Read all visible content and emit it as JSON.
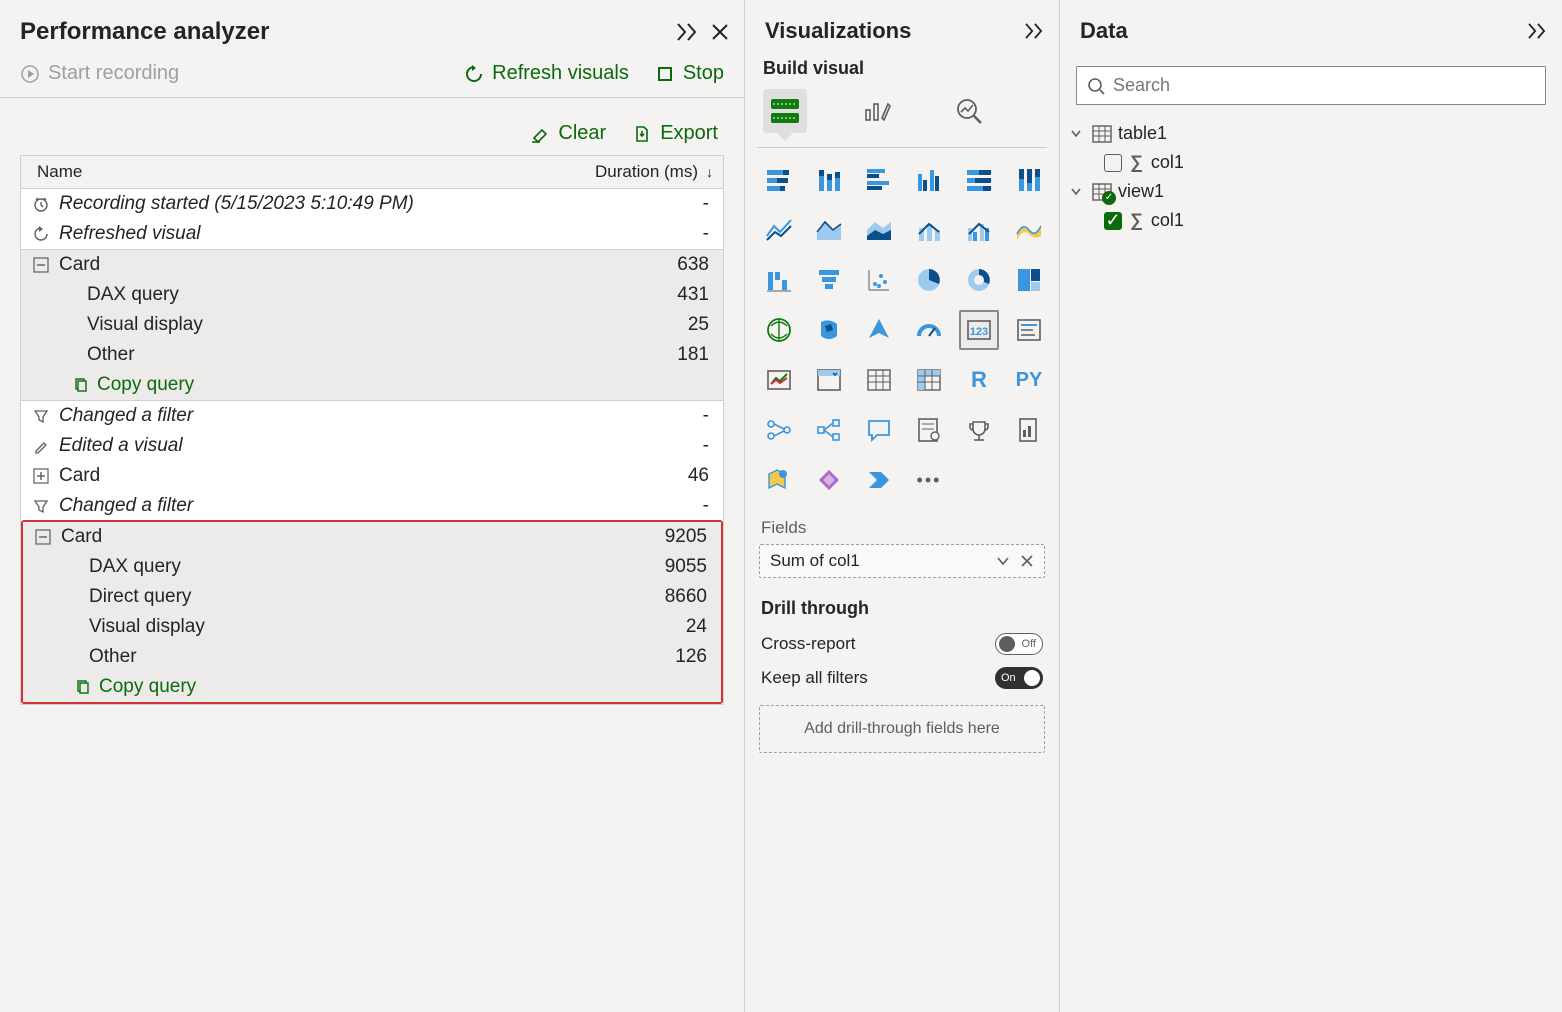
{
  "perf": {
    "title": "Performance analyzer",
    "start_recording": "Start recording",
    "refresh": "Refresh visuals",
    "stop": "Stop",
    "clear": "Clear",
    "export": "Export",
    "table": {
      "col_name": "Name",
      "col_duration": "Duration (ms)"
    },
    "rows": {
      "recording_started": "Recording started (5/15/2023 5:10:49 PM)",
      "refreshed_visual": "Refreshed visual",
      "card1": {
        "label": "Card",
        "dur": "638",
        "dax": "DAX query",
        "dax_dur": "431",
        "vd": "Visual display",
        "vd_dur": "25",
        "other": "Other",
        "other_dur": "181"
      },
      "copy_query": "Copy query",
      "changed_filter": "Changed a filter",
      "edited_visual": "Edited a visual",
      "card2": {
        "label": "Card",
        "dur": "46"
      },
      "changed_filter2": "Changed a filter",
      "card3": {
        "label": "Card",
        "dur": "9205",
        "dax": "DAX query",
        "dax_dur": "9055",
        "dq": "Direct query",
        "dq_dur": "8660",
        "vd": "Visual display",
        "vd_dur": "24",
        "other": "Other",
        "other_dur": "126"
      }
    }
  },
  "viz": {
    "title": "Visualizations",
    "subtitle": "Build visual",
    "fields_label": "Fields",
    "field_value": "Sum of col1",
    "drill_title": "Drill through",
    "cross_report": "Cross-report",
    "cross_report_state": "Off",
    "keep_filters": "Keep all filters",
    "keep_filters_state": "On",
    "drill_drop": "Add drill-through fields here"
  },
  "data": {
    "title": "Data",
    "search_placeholder": "Search",
    "tables": [
      {
        "name": "table1",
        "cols": [
          "col1"
        ],
        "checked": false
      },
      {
        "name": "view1",
        "cols": [
          "col1"
        ],
        "checked": true,
        "badge": true
      }
    ]
  }
}
